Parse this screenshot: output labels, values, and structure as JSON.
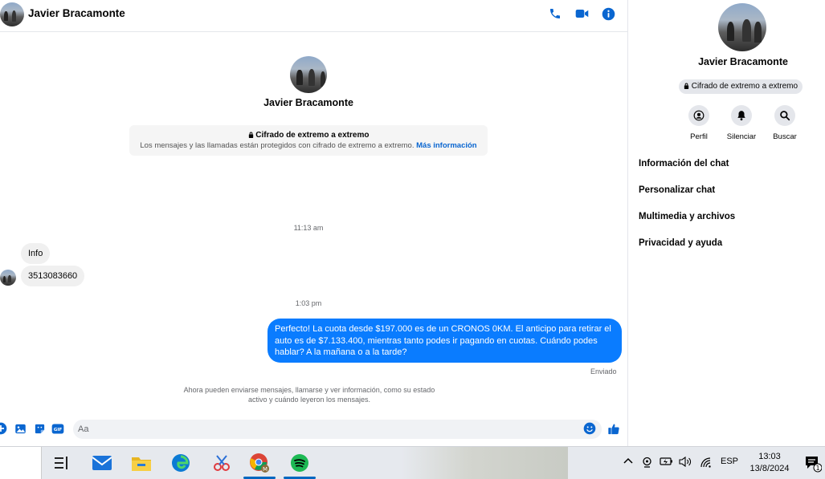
{
  "contact": {
    "name": "Javier Bracamonte"
  },
  "header": {
    "call_icon": "phone-icon",
    "video_icon": "video-camera-icon",
    "info_icon": "info-icon"
  },
  "intro": {
    "name": "Javier Bracamonte",
    "e2e_title": "Cifrado de extremo a extremo",
    "e2e_desc": "Los mensajes y las llamadas están protegidos con cifrado de extremo a extremo.",
    "e2e_link": "Más información"
  },
  "messages": {
    "time1": "11:13 am",
    "in1": "Info",
    "in2": "3513083660",
    "time2": "1:03 pm",
    "out1": "Perfecto! La cuota desde $197.000 es de un CRONOS 0KM. El anticipo para retirar el auto es de $7.133.400, mientras tanto podes ir pagando en cuotas. Cuándo podes hablar? A la mañana o a la tarde?",
    "sent_status": "Enviado",
    "notice": "Ahora pueden enviarse mensajes, llamarse y ver información, como su estado activo y cuándo leyeron los mensajes."
  },
  "composer": {
    "placeholder": "Aa",
    "value": "",
    "gif_label": "GIF"
  },
  "panel": {
    "name": "Javier Bracamonte",
    "e2e_badge": "Cifrado de extremo a extremo",
    "actions": [
      {
        "label": "Perfil",
        "icon": "profile-icon"
      },
      {
        "label": "Silenciar",
        "icon": "bell-icon"
      },
      {
        "label": "Buscar",
        "icon": "search-icon"
      }
    ],
    "menu": [
      "Información del chat",
      "Personalizar chat",
      "Multimedia y archivos",
      "Privacidad y ayuda"
    ]
  },
  "taskbar": {
    "language": "ESP",
    "time": "13:03",
    "date": "13/8/2024",
    "notification_count": "1",
    "chrome_badge": "M"
  },
  "colors": {
    "accent": "#0a7cff",
    "header_icon": "#0a66d0",
    "bubble_in": "#f0f0f0"
  }
}
